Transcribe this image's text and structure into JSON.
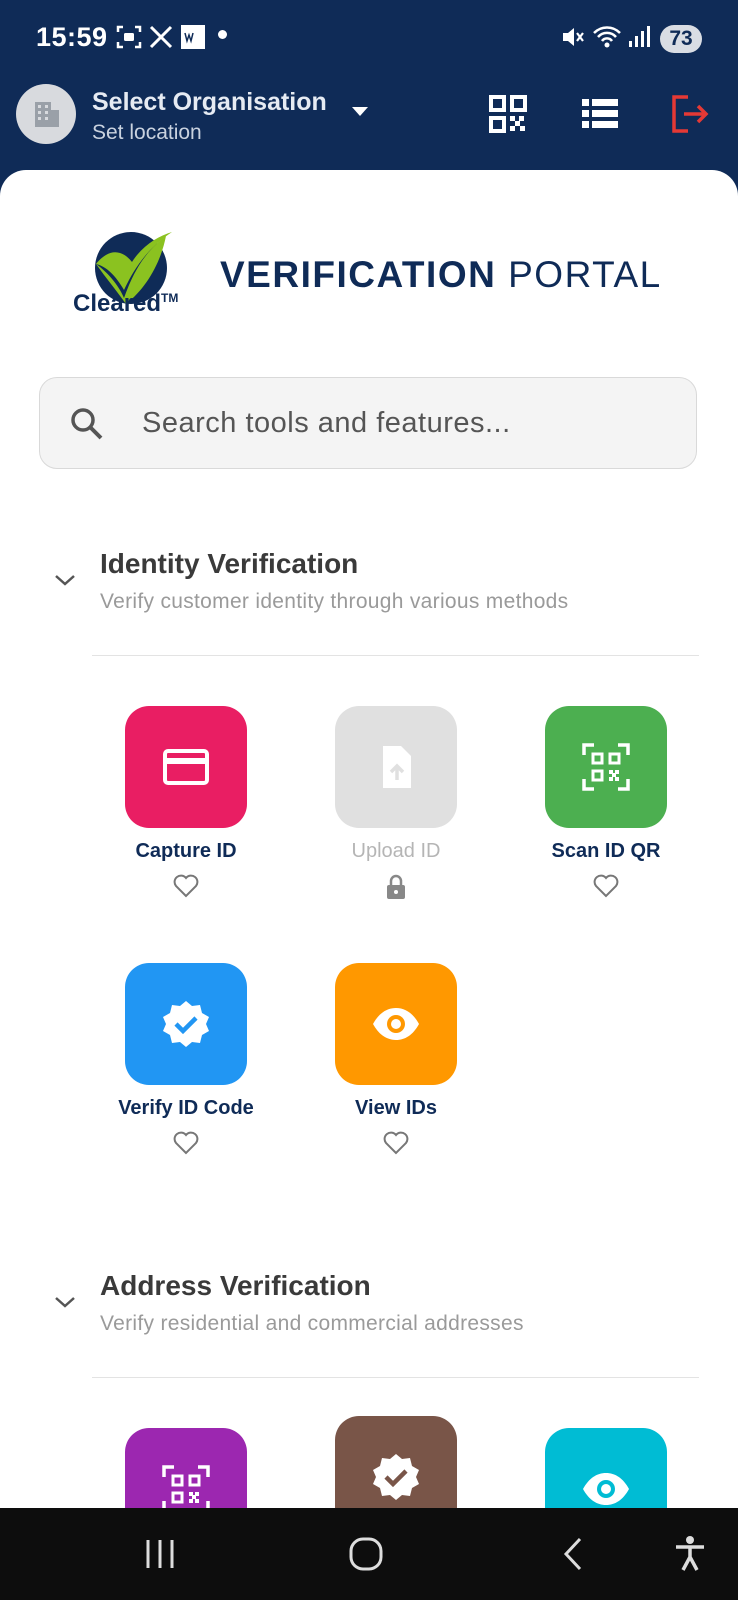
{
  "status_bar": {
    "time": "15:59",
    "battery": "73"
  },
  "header": {
    "org_title": "Select Organisation",
    "org_subtitle": "Set location"
  },
  "brand": {
    "logo_text": "Cleared",
    "trademark": "TM",
    "title_bold": "VERIFICATION",
    "title_light": "PORTAL"
  },
  "search": {
    "placeholder": "Search tools and features..."
  },
  "sections": [
    {
      "title": "Identity Verification",
      "subtitle": "Verify customer identity through various methods",
      "tools": [
        {
          "label": "Capture ID",
          "icon": "id-card-icon",
          "color": "#e91e63",
          "enabled": true
        },
        {
          "label": "Upload ID",
          "icon": "upload-file-icon",
          "color": "#e0e0e0",
          "enabled": false
        },
        {
          "label": "Scan ID QR",
          "icon": "qr-scan-icon",
          "color": "#4caf50",
          "enabled": true
        },
        {
          "label": "Verify ID Code",
          "icon": "verified-badge-icon",
          "color": "#2196f3",
          "enabled": true
        },
        {
          "label": "View IDs",
          "icon": "eye-icon",
          "color": "#ff9800",
          "enabled": true
        }
      ]
    },
    {
      "title": "Address Verification",
      "subtitle": "Verify residential and commercial addresses",
      "tools": [
        {
          "icon": "qr-scan-icon",
          "color": "#9c27b0"
        },
        {
          "icon": "verified-badge-icon",
          "color": "#795548"
        },
        {
          "icon": "eye-icon",
          "color": "#00bcd4"
        }
      ]
    }
  ],
  "colors": {
    "navy": "#0f2b57",
    "logout": "#e53935",
    "logo_green": "#8bc220"
  }
}
